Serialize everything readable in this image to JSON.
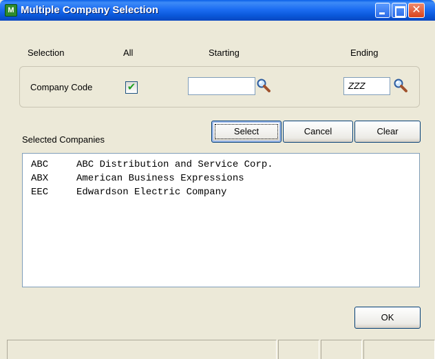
{
  "window": {
    "title": "Multiple Company Selection",
    "icon_text": "M"
  },
  "icons": {
    "app": "multiple-company-app-icon",
    "minimize": "minimize-icon",
    "maximize": "maximize-icon",
    "close": "close-icon",
    "lookup": "magnifier-lookup-icon",
    "check": "checkmark-icon"
  },
  "close_glyph": "✕",
  "check_glyph": "✔",
  "headers": {
    "selection": "Selection",
    "all": "All",
    "starting": "Starting",
    "ending": "Ending"
  },
  "company_code": {
    "label": "Company Code",
    "all_checked": true,
    "starting_value": "",
    "ending_value": "ZZZ"
  },
  "buttons": {
    "select": "Select",
    "cancel": "Cancel",
    "clear": "Clear",
    "ok": "OK"
  },
  "selected_label": "Selected Companies",
  "companies": [
    {
      "code": "ABC",
      "name": "ABC Distribution and Service Corp."
    },
    {
      "code": "ABX",
      "name": "American Business Expressions"
    },
    {
      "code": "EEC",
      "name": "Edwardson Electric Company"
    }
  ],
  "colors": {
    "titlebar": "#0A58DA",
    "window_bg": "#ECE9D8",
    "check": "#21A121"
  }
}
